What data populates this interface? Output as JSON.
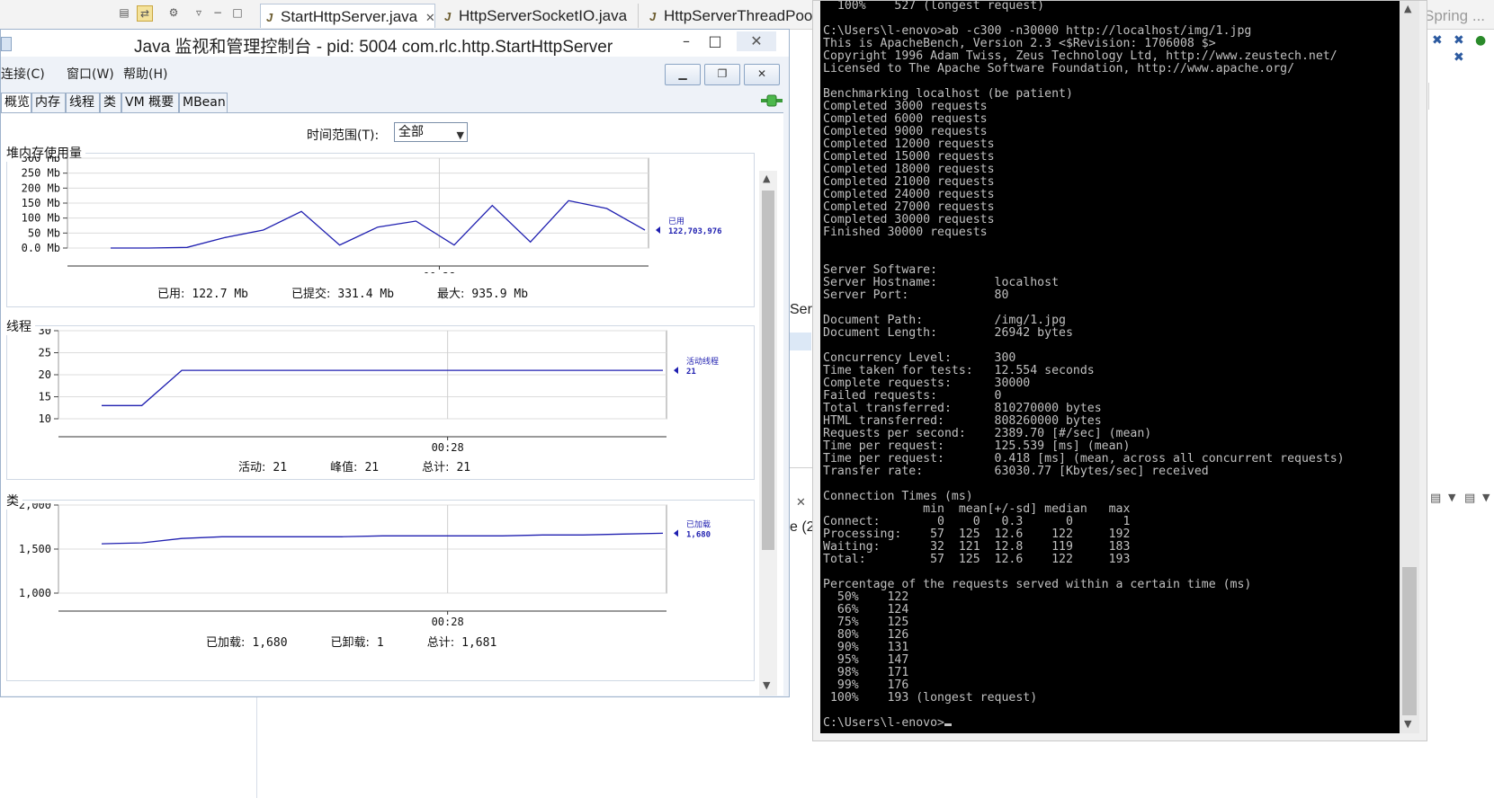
{
  "eclipse": {
    "tabs": [
      "StartHttpServer.java",
      "HttpServerSocketIO.java",
      "HttpServerThreadPool"
    ],
    "perspective_label": "Spring ...",
    "side_fragments": [
      "Serv",
      "e (2"
    ]
  },
  "jconsole": {
    "title": "Java 监视和管理控制台 - pid: 5004 com.rlc.http.StartHttpServer",
    "menu": [
      "连接(C)",
      "窗口(W)",
      "帮助(H)"
    ],
    "tabs": [
      "概览",
      "内存",
      "线程",
      "类",
      "VM 概要",
      "MBean"
    ],
    "active_tab": "概览",
    "time_range_label": "时间范围(T):",
    "time_range_value": "全部",
    "heap": {
      "title": "堆内存使用量",
      "legend_label": "已用",
      "legend_value": "122,703,976",
      "stats": [
        {
          "label": "已用:",
          "value": "122.7  Mb"
        },
        {
          "label": "已提交:",
          "value": "331.4  Mb"
        },
        {
          "label": "最大:",
          "value": "935.9  Mb"
        }
      ]
    },
    "threads": {
      "title": "线程",
      "legend_label": "活动线程",
      "legend_value": "21",
      "stats": [
        {
          "label": "活动:",
          "value": "21"
        },
        {
          "label": "峰值:",
          "value": "21"
        },
        {
          "label": "总计:",
          "value": "21"
        }
      ]
    },
    "classes": {
      "title": "类",
      "legend_label": "已加载",
      "legend_value": "1,680",
      "stats": [
        {
          "label": "已加载:",
          "value": "1,680"
        },
        {
          "label": "已卸载:",
          "value": "1"
        },
        {
          "label": "总计:",
          "value": "1,681"
        }
      ]
    }
  },
  "chart_data": [
    {
      "type": "line",
      "title": "堆内存使用量",
      "ytick_labels": [
        "0.0 Mb",
        "50 Mb",
        "100 Mb",
        "150 Mb",
        "200 Mb",
        "250 Mb",
        "300 Mb"
      ],
      "ylim": [
        0,
        300
      ],
      "xtick_labels": [
        "00:28"
      ],
      "series": [
        {
          "name": "已用",
          "values": [
            0,
            0,
            2,
            35,
            60,
            122,
            10,
            70,
            90,
            10,
            142,
            20,
            158,
            132,
            60
          ]
        }
      ],
      "grid": true,
      "legend": "right"
    },
    {
      "type": "line",
      "title": "线程",
      "ytick_labels": [
        "10",
        "15",
        "20",
        "25",
        "30"
      ],
      "ylim": [
        10,
        30
      ],
      "xtick_labels": [
        "00:28"
      ],
      "series": [
        {
          "name": "活动线程",
          "values": [
            13,
            13,
            21,
            21,
            21,
            21,
            21,
            21,
            21,
            21,
            21,
            21,
            21,
            21,
            21
          ]
        }
      ],
      "grid": true,
      "legend": "right"
    },
    {
      "type": "line",
      "title": "类",
      "ytick_labels": [
        "1,000",
        "1,500",
        "2,000"
      ],
      "ylim": [
        1000,
        2000
      ],
      "xtick_labels": [
        "00:28"
      ],
      "series": [
        {
          "name": "已加载",
          "values": [
            1560,
            1570,
            1620,
            1640,
            1640,
            1640,
            1640,
            1650,
            1650,
            1650,
            1650,
            1660,
            1660,
            1670,
            1680
          ]
        }
      ],
      "grid": true,
      "legend": "right"
    }
  ],
  "cmd": {
    "lines": [
      "  100%    527 (longest request)",
      "",
      "C:\\Users\\l-enovo>ab -c300 -n30000 http://localhost/img/1.jpg",
      "This is ApacheBench, Version 2.3 <$Revision: 1706008 $>",
      "Copyright 1996 Adam Twiss, Zeus Technology Ltd, http://www.zeustech.net/",
      "Licensed to The Apache Software Foundation, http://www.apache.org/",
      "",
      "Benchmarking localhost (be patient)",
      "Completed 3000 requests",
      "Completed 6000 requests",
      "Completed 9000 requests",
      "Completed 12000 requests",
      "Completed 15000 requests",
      "Completed 18000 requests",
      "Completed 21000 requests",
      "Completed 24000 requests",
      "Completed 27000 requests",
      "Completed 30000 requests",
      "Finished 30000 requests",
      "",
      "",
      "Server Software:",
      "Server Hostname:        localhost",
      "Server Port:            80",
      "",
      "Document Path:          /img/1.jpg",
      "Document Length:        26942 bytes",
      "",
      "Concurrency Level:      300",
      "Time taken for tests:   12.554 seconds",
      "Complete requests:      30000",
      "Failed requests:        0",
      "Total transferred:      810270000 bytes",
      "HTML transferred:       808260000 bytes",
      "Requests per second:    2389.70 [#/sec] (mean)",
      "Time per request:       125.539 [ms] (mean)",
      "Time per request:       0.418 [ms] (mean, across all concurrent requests)",
      "Transfer rate:          63030.77 [Kbytes/sec] received",
      "",
      "Connection Times (ms)",
      "              min  mean[+/-sd] median   max",
      "Connect:        0    0   0.3      0       1",
      "Processing:    57  125  12.6    122     192",
      "Waiting:       32  121  12.8    119     183",
      "Total:         57  125  12.6    122     193",
      "",
      "Percentage of the requests served within a certain time (ms)",
      "  50%    122",
      "  66%    124",
      "  75%    125",
      "  80%    126",
      "  90%    131",
      "  95%    147",
      "  98%    171",
      "  99%    176",
      " 100%    193 (longest request)",
      "",
      "C:\\Users\\l-enovo>"
    ]
  }
}
